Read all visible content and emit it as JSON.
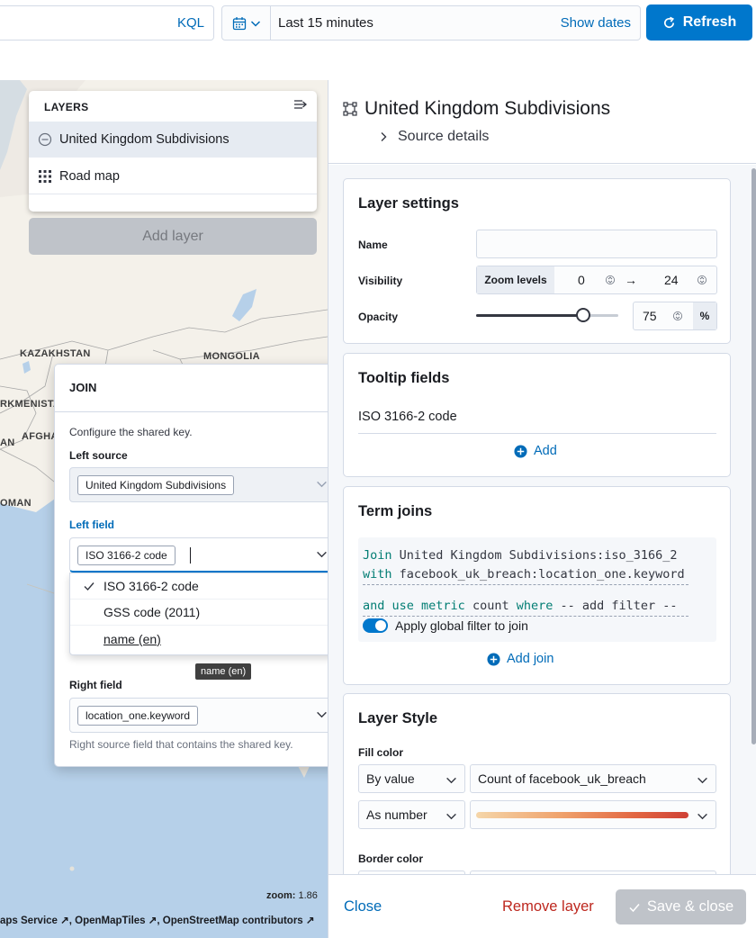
{
  "topbar": {
    "kql_label": "KQL",
    "date_range": "Last 15 minutes",
    "show_dates_label": "Show dates",
    "refresh_label": "Refresh"
  },
  "map": {
    "labels": [
      "KAZAKHSTAN",
      "MONGOLIA",
      "RKMENISTA",
      "AN",
      "AFGHA",
      "OMAN"
    ],
    "zoom_label": "zoom:",
    "zoom_value": "1.86",
    "attribution": [
      "aps Service",
      "OpenMapTiles",
      "OpenStreetMap contributors"
    ]
  },
  "layers": {
    "title": "LAYERS",
    "items": [
      {
        "label": "United Kingdom Subdivisions"
      },
      {
        "label": "Road map"
      }
    ],
    "add_layer_label": "Add layer"
  },
  "join": {
    "title": "JOIN",
    "description": "Configure the shared key.",
    "left_source_label": "Left source",
    "left_source_value": "United Kingdom Subdivisions",
    "left_field_label": "Left field",
    "left_field_value": "ISO 3166-2 code",
    "options": [
      "ISO 3166-2 code",
      "GSS code (2011)",
      "name (en)"
    ],
    "tooltip": "name (en)",
    "right_field_label": "Right field",
    "right_field_value": "location_one.keyword",
    "right_field_help": "Right source field that contains the shared key."
  },
  "flyout": {
    "title": "United Kingdom Subdivisions",
    "source_details_label": "Source details",
    "layer_settings": {
      "title": "Layer settings",
      "name_label": "Name",
      "name_value": "",
      "visibility_label": "Visibility",
      "zoom_levels_label": "Zoom levels",
      "zoom_min": "0",
      "zoom_max": "24",
      "opacity_label": "Opacity",
      "opacity_value": "75",
      "opacity_unit": "%"
    },
    "tooltip_fields": {
      "title": "Tooltip fields",
      "field": "ISO 3166-2 code",
      "add_label": "Add"
    },
    "term_joins": {
      "title": "Term joins",
      "kw_join": "Join",
      "join_left": "United Kingdom Subdivisions:iso_3166_2",
      "kw_with": "with",
      "join_right": "facebook_uk_breach:location_one.keyword",
      "kw_and_use_metric": "and use metric",
      "metric": "count",
      "kw_where": "where",
      "filter": "-- add filter --",
      "global_filter_label": "Apply global filter to join",
      "add_join_label": "Add join"
    },
    "layer_style": {
      "title": "Layer Style",
      "fill_color_label": "Fill color",
      "fill_by": "By value",
      "fill_field": "Count of facebook_uk_breach",
      "fill_as": "As number",
      "border_color_label": "Border color"
    },
    "footer": {
      "close_label": "Close",
      "remove_label": "Remove layer",
      "save_label": "Save & close"
    }
  },
  "colors": {
    "primary": "#0077cc",
    "link": "#006bb8",
    "danger": "#bd271e",
    "code_keyword": "#017d73",
    "map_water": "#b6d0e9",
    "map_land": "#f4f1ea"
  }
}
